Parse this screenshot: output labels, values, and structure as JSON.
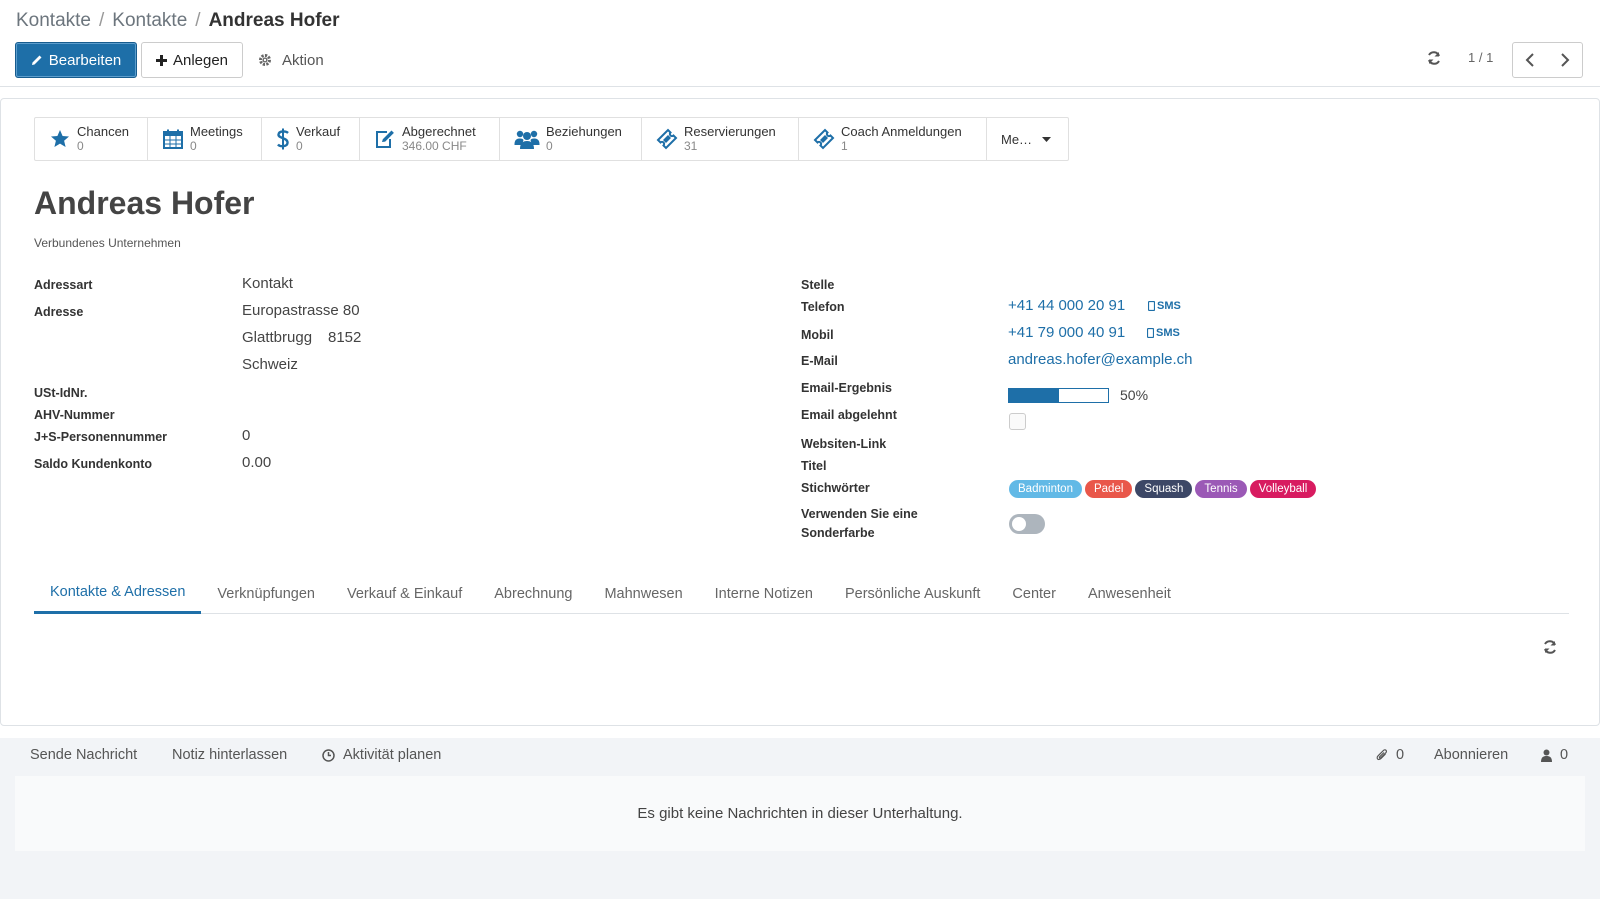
{
  "breadcrumb": {
    "items": [
      "Kontakte",
      "Kontakte"
    ],
    "current": "Andreas Hofer"
  },
  "toolbar": {
    "edit_label": "Bearbeiten",
    "create_label": "Anlegen",
    "action_label": "Aktion",
    "pager_value": "1 / 1"
  },
  "stat_buttons": [
    {
      "label": "Chancen",
      "value": "0",
      "icon": "star-icon"
    },
    {
      "label": "Meetings",
      "value": "0",
      "icon": "calendar-icon"
    },
    {
      "label": "Verkauf",
      "value": "0",
      "icon": "dollar-icon"
    },
    {
      "label": "Abgerechnet",
      "value": "346.00 CHF",
      "icon": "edit-icon"
    },
    {
      "label": "Beziehungen",
      "value": "0",
      "icon": "users-icon"
    },
    {
      "label": "Reservierungen",
      "value": "31",
      "icon": "ticket-icon"
    },
    {
      "label": "Coach Anmeldungen",
      "value": "1",
      "icon": "ticket-icon"
    }
  ],
  "more_button": "Me…",
  "partner": {
    "name": "Andreas Hofer",
    "parent_label": "Verbundenes Unternehmen"
  },
  "left_fields": {
    "address_type_label": "Adressart",
    "address_type_value": "Kontakt",
    "address_label": "Adresse",
    "street": "Europastrasse 80",
    "city": "Glattbrugg",
    "zip": "8152",
    "country": "Schweiz",
    "vat_label": "USt-IdNr.",
    "ahv_label": "AHV-Nummer",
    "js_label": "J+S-Personennummer",
    "js_value": "0",
    "balance_label": "Saldo Kundenkonto",
    "balance_value": "0.00"
  },
  "right_fields": {
    "function_label": "Stelle",
    "phone_label": "Telefon",
    "phone_value": "+41 44 000 20 91",
    "mobile_label": "Mobil",
    "mobile_value": "+41 79 000 40 91",
    "sms_label": "SMS",
    "email_label": "E-Mail",
    "email_value": "andreas.hofer@example.ch",
    "email_result_label": "Email-Ergebnis",
    "email_result_percent": 50,
    "email_result_text": "50%",
    "email_refused_label": "Email abgelehnt",
    "email_refused_checked": false,
    "website_label": "Websiten-Link",
    "title_label": "Titel",
    "tags_label": "Stichwörter",
    "color_label": "Verwenden Sie eine Sonderfarbe",
    "color_toggle_on": false
  },
  "tags": [
    {
      "name": "Badminton",
      "color": "#62b9e6"
    },
    {
      "name": "Padel",
      "color": "#e9574a"
    },
    {
      "name": "Squash",
      "color": "#3c4766"
    },
    {
      "name": "Tennis",
      "color": "#9b59b6"
    },
    {
      "name": "Volleyball",
      "color": "#d81b60"
    }
  ],
  "tabs": [
    {
      "label": "Kontakte & Adressen",
      "active": true
    },
    {
      "label": "Verknüpfungen",
      "active": false
    },
    {
      "label": "Verkauf & Einkauf",
      "active": false
    },
    {
      "label": "Abrechnung",
      "active": false
    },
    {
      "label": "Mahnwesen",
      "active": false
    },
    {
      "label": "Interne Notizen",
      "active": false
    },
    {
      "label": "Persönliche Auskunft",
      "active": false
    },
    {
      "label": "Center",
      "active": false
    },
    {
      "label": "Anwesenheit",
      "active": false
    }
  ],
  "chatter": {
    "send_message": "Sende Nachricht",
    "log_note": "Notiz hinterlassen",
    "schedule_activity": "Aktivität planen",
    "attachments_count": "0",
    "follow": "Abonnieren",
    "followers_count": "0",
    "empty_message": "Es gibt keine Nachrichten in dieser Unterhaltung."
  },
  "colors": {
    "primary": "#1e6fa8"
  }
}
